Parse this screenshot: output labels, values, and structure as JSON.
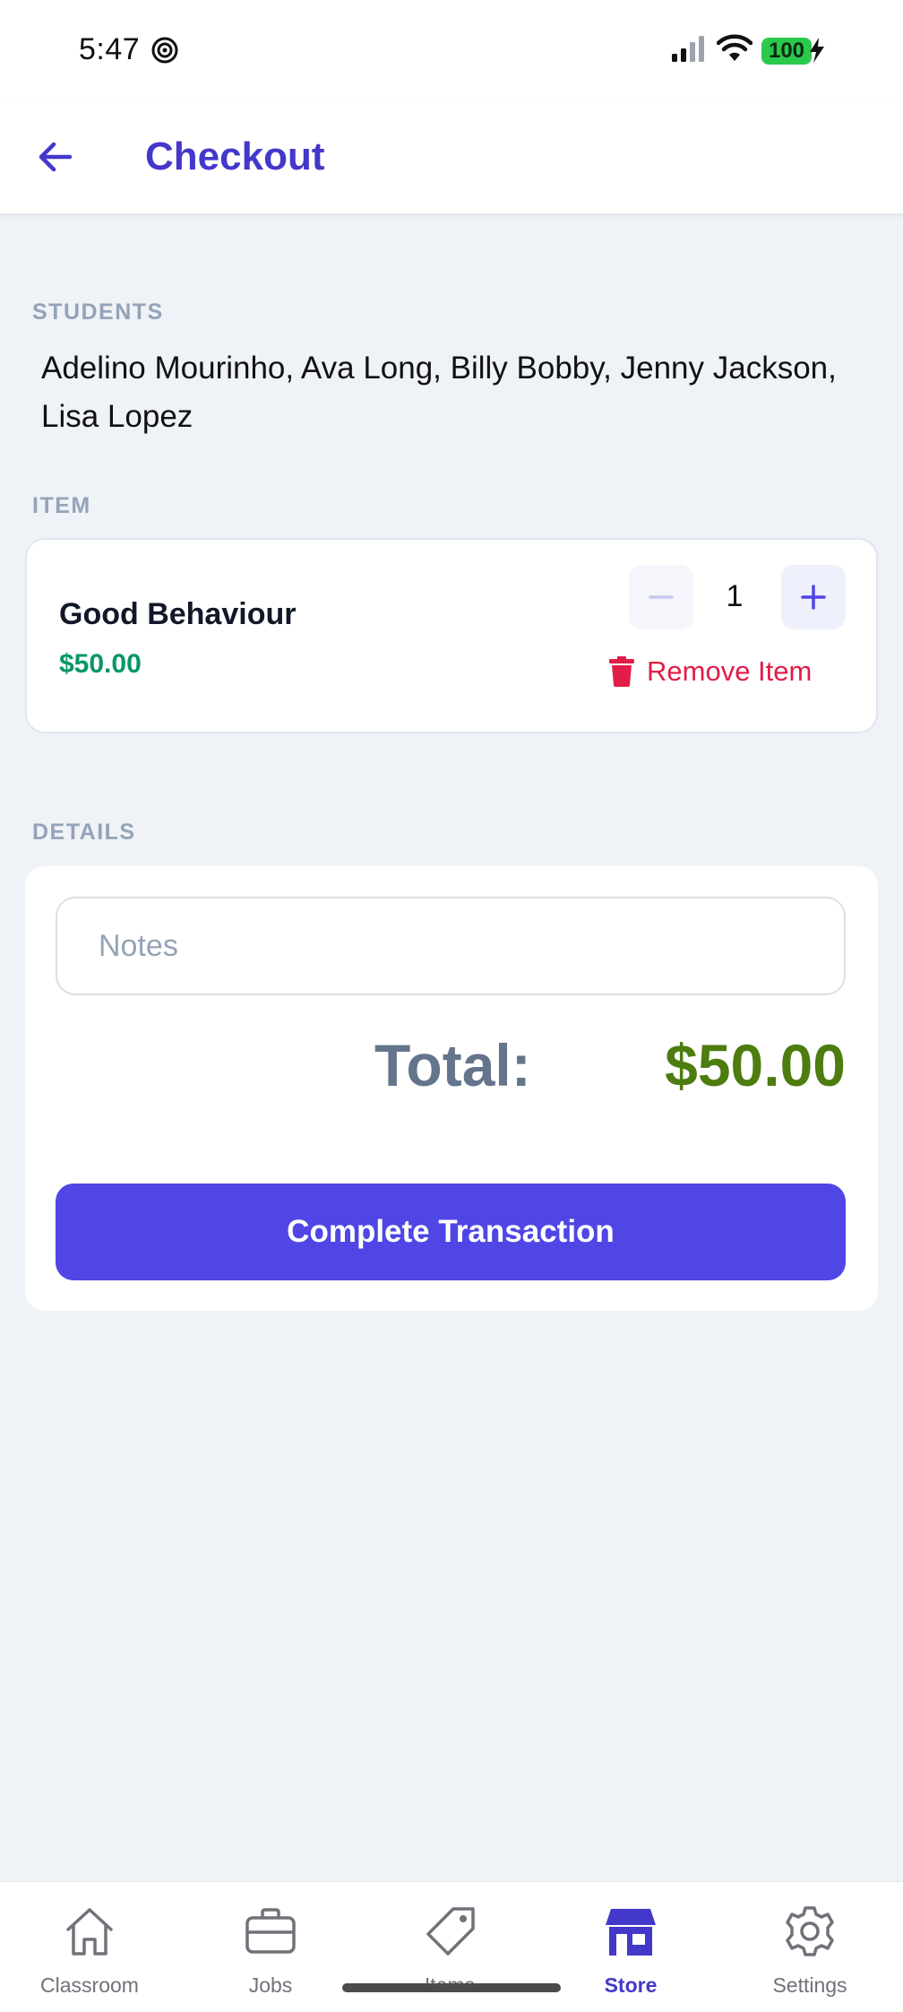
{
  "status_bar": {
    "time": "5:47",
    "battery": "100",
    "icons": [
      "focus-icon",
      "signal-icon",
      "wifi-icon",
      "battery-icon",
      "charging-bolt-icon"
    ]
  },
  "header": {
    "title": "Checkout",
    "back_icon": "arrow-left-icon"
  },
  "students": {
    "label": "STUDENTS",
    "names": "Adelino Mourinho, Ava Long, Billy Bobby, Jenny Jackson, Lisa Lopez"
  },
  "item_section": {
    "label": "ITEM",
    "item": {
      "name": "Good Behaviour",
      "price": "$50.00",
      "quantity": "1",
      "remove_label": "Remove Item"
    }
  },
  "details": {
    "label": "DETAILS",
    "notes_placeholder": "Notes",
    "notes_value": "",
    "total_label": "Total:",
    "total_value": "$50.00",
    "complete_label": "Complete Transaction"
  },
  "bottom_nav": {
    "active": "Store",
    "items": [
      {
        "label": "Classroom",
        "icon": "home-icon"
      },
      {
        "label": "Jobs",
        "icon": "briefcase-icon"
      },
      {
        "label": "Items",
        "icon": "tag-icon"
      },
      {
        "label": "Store",
        "icon": "store-icon"
      },
      {
        "label": "Settings",
        "icon": "gear-icon"
      }
    ]
  },
  "colors": {
    "accent": "#4f46e5",
    "title": "#4338ca",
    "price_green": "#079669",
    "total_green": "#4d7c0f",
    "danger": "#e11d48",
    "background": "#eff2f7"
  }
}
